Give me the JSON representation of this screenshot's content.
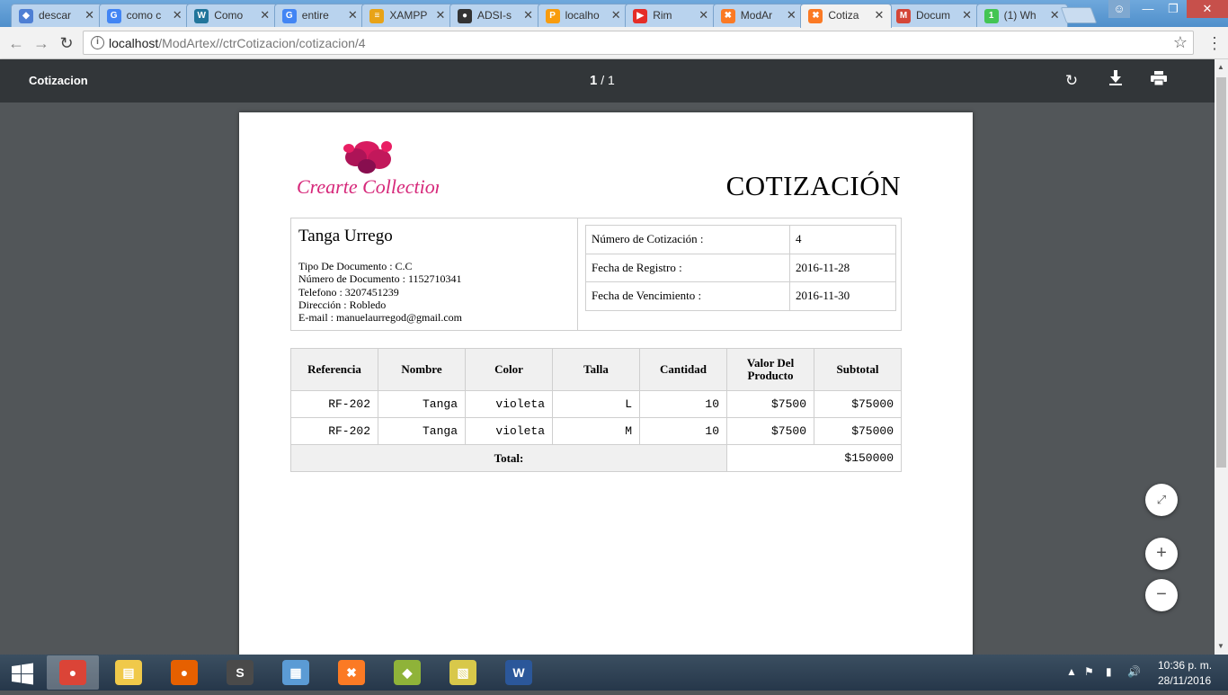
{
  "browser": {
    "tabs": [
      {
        "label": "descar",
        "favicon": "diamond-icon",
        "color": "#4e7fd4"
      },
      {
        "label": "como c",
        "favicon": "google-icon",
        "color": "#4285f4"
      },
      {
        "label": "Como",
        "favicon": "wordpress-icon",
        "color": "#21759b"
      },
      {
        "label": "entire",
        "favicon": "google-icon",
        "color": "#4285f4"
      },
      {
        "label": "XAMPP",
        "favicon": "stack-icon",
        "color": "#e8a317"
      },
      {
        "label": "ADSI-s",
        "favicon": "github-icon",
        "color": "#333333"
      },
      {
        "label": "localho",
        "favicon": "phpmyadmin-icon",
        "color": "#f89c0e"
      },
      {
        "label": "Rim",
        "favicon": "youtube-icon",
        "color": "#e52d27"
      },
      {
        "label": "ModAr",
        "favicon": "xampp-icon",
        "color": "#fb7a24"
      },
      {
        "label": "Cotiza",
        "favicon": "xampp-icon",
        "color": "#fb7a24"
      },
      {
        "label": "Docum",
        "favicon": "gmail-icon",
        "color": "#d44638"
      },
      {
        "label": "(1) Wh",
        "favicon": "whatsapp-icon",
        "color": "#43c553"
      }
    ],
    "active_tab": 9,
    "url_host": "localhost",
    "url_path": "/ModArtex//ctrCotizacion/cotizacion/4"
  },
  "pdf_viewer": {
    "title": "Cotizacion",
    "current_page": "1",
    "page_separator": "/",
    "total_pages": "1"
  },
  "document": {
    "logo_text": "Crearte Collection",
    "heading": "COTIZACIÓN",
    "client": {
      "name": "Tanga Urrego",
      "details": [
        "Tipo De Documento : C.C",
        "Número de Documento : 1152710341",
        "Telefono : 3207451239",
        "Dirección : Robledo",
        "E-mail : manuelaurregod@gmail.com"
      ]
    },
    "meta": [
      {
        "label": "Número de Cotización :",
        "value": "4"
      },
      {
        "label": "Fecha de Registro :",
        "value": "2016-11-28"
      },
      {
        "label": "Fecha de Vencimiento :",
        "value": "2016-11-30"
      }
    ],
    "table": {
      "headers": [
        "Referencia",
        "Nombre",
        "Color",
        "Talla",
        "Cantidad",
        "Valor Del Producto",
        "Subtotal"
      ],
      "rows": [
        [
          "RF-202",
          "Tanga",
          "violeta",
          "L",
          "10",
          "$7500",
          "$75000"
        ],
        [
          "RF-202",
          "Tanga",
          "violeta",
          "M",
          "10",
          "$7500",
          "$75000"
        ]
      ],
      "total_label": "Total:",
      "total_value": "$150000"
    }
  },
  "taskbar": {
    "apps": [
      {
        "name": "chrome",
        "active": true
      },
      {
        "name": "file-explorer",
        "active": false
      },
      {
        "name": "firefox",
        "active": false
      },
      {
        "name": "sublime-text",
        "active": false
      },
      {
        "name": "control-panel",
        "active": false
      },
      {
        "name": "xampp",
        "active": false
      },
      {
        "name": "git",
        "active": false
      },
      {
        "name": "sticky-notes",
        "active": false
      },
      {
        "name": "word",
        "active": false
      }
    ],
    "time": "10:36 p. m.",
    "date": "28/11/2016"
  }
}
